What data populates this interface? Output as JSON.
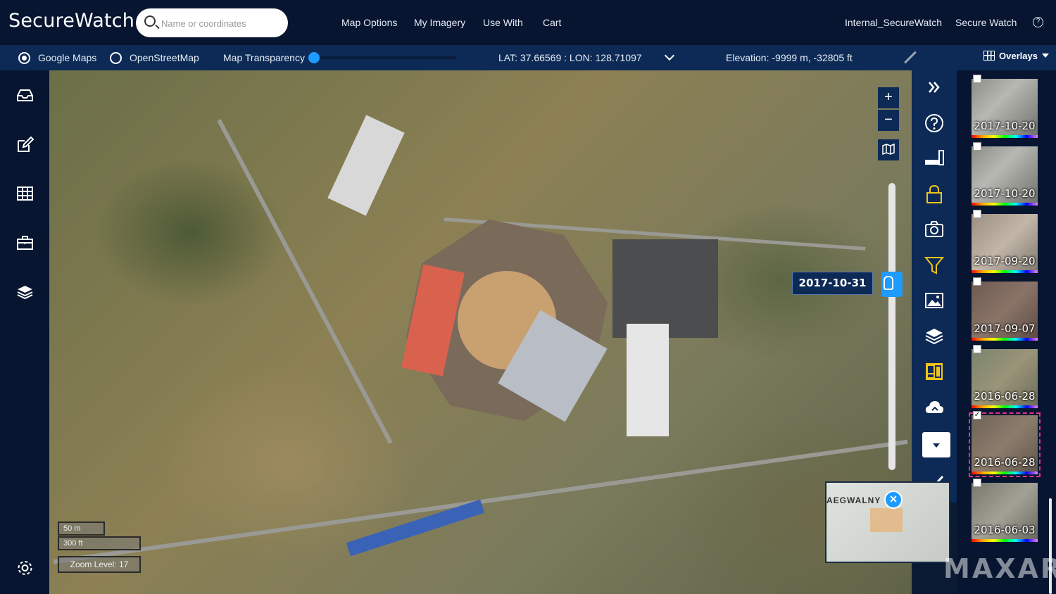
{
  "app": {
    "title": "SecureWatch"
  },
  "search": {
    "placeholder": "Name or coordinates"
  },
  "topnav": {
    "items": [
      "Map Options",
      "My Imagery",
      "Use With",
      "Cart"
    ],
    "account": "Internal_SecureWatch",
    "product": "Secure Watch",
    "help": "?"
  },
  "basemap": {
    "options": [
      {
        "label": "Google Maps",
        "selected": true
      },
      {
        "label": "OpenStreetMap",
        "selected": false
      }
    ],
    "transparency_label": "Map Transparency",
    "transparency_value": 0
  },
  "readout": {
    "coords": "LAT: 37.66569 : LON: 128.71097",
    "elevation": "Elevation: -9999 m, -32805 ft"
  },
  "overlays": {
    "label": "Overlays"
  },
  "map": {
    "zoom_in": "+",
    "zoom_out": "−",
    "date_tooltip": "2017-10-31",
    "scale": {
      "meters": "50 m",
      "feet": "300 ft"
    },
    "zoom_level": "Zoom Level: 17",
    "minimap_text": "AEGWALNY",
    "minimap_close": "✕"
  },
  "left_icons": [
    "inbox-icon",
    "edit-icon",
    "grid-icon",
    "briefcase-icon",
    "layers-icon",
    "settings-icon"
  ],
  "tool_icons": [
    "double-chevron-right-icon",
    "help-icon",
    "signal-bar-icon",
    "lock-icon",
    "camera-icon",
    "filter-icon",
    "image-icon",
    "layers-icon",
    "id-card-icon",
    "cloud-icon",
    "dropdown-icon",
    "check-icon"
  ],
  "imagery": [
    {
      "date": "2017-10-20",
      "checked": false,
      "selected": false
    },
    {
      "date": "2017-10-20",
      "checked": false,
      "selected": false
    },
    {
      "date": "2017-09-20",
      "checked": false,
      "selected": false
    },
    {
      "date": "2017-09-07",
      "checked": false,
      "selected": false
    },
    {
      "date": "2016-06-28",
      "checked": false,
      "selected": false
    },
    {
      "date": "2016-06-28",
      "checked": true,
      "selected": true
    },
    {
      "date": "2016-06-03",
      "checked": false,
      "selected": false
    }
  ],
  "watermark": "MAXAR",
  "colors": {
    "topbar": "#071530",
    "subbar": "#0c2a55",
    "accent": "#1e9bff",
    "selection": "#e0338a"
  }
}
